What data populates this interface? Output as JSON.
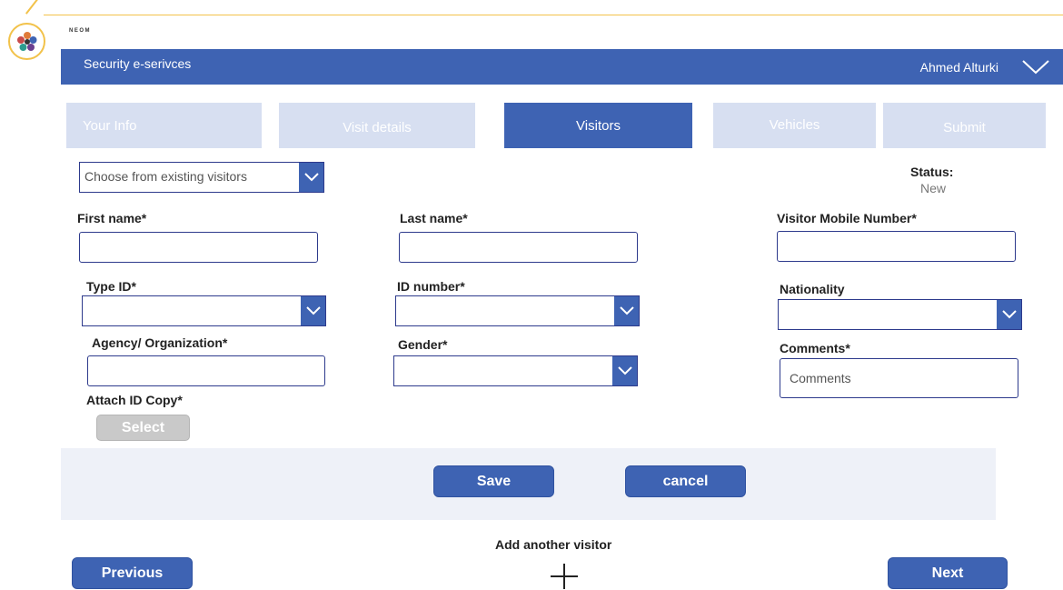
{
  "brand": {
    "name": "NEOM"
  },
  "header": {
    "title": "Security e-serivces",
    "user": "Ahmed Alturki"
  },
  "tabs": [
    {
      "label": "Your Info",
      "active": false
    },
    {
      "label": "Visit details",
      "active": false
    },
    {
      "label": "Visitors",
      "active": true
    },
    {
      "label": "Vehicles",
      "active": false
    },
    {
      "label": "Submit",
      "active": false
    }
  ],
  "visitor_picker": {
    "placeholder": "Choose from existing visitors"
  },
  "status": {
    "label": "Status:",
    "value": "New"
  },
  "form": {
    "first_name": {
      "label": "First name*",
      "value": ""
    },
    "last_name": {
      "label": "Last name*",
      "value": ""
    },
    "mobile": {
      "label": "Visitor Mobile Number*",
      "value": ""
    },
    "type_id": {
      "label": "Type ID*",
      "value": ""
    },
    "id_number": {
      "label": "ID number*",
      "value": ""
    },
    "nationality": {
      "label": "Nationality",
      "value": ""
    },
    "agency": {
      "label": "Agency/ Organization*",
      "value": ""
    },
    "gender": {
      "label": "Gender*",
      "value": ""
    },
    "comments": {
      "label": "Comments*",
      "placeholder": "Comments"
    },
    "attach": {
      "label": "Attach ID Copy*",
      "button": "Select"
    }
  },
  "actions": {
    "save": "Save",
    "cancel": "cancel"
  },
  "footer": {
    "add_visitor": "Add another visitor",
    "previous": "Previous",
    "next": "Next"
  },
  "colors": {
    "primary": "#3e63b3",
    "tab_inactive": "#d7dff1",
    "accent": "#f2c24a",
    "border": "#2d3a8c"
  },
  "icons": {
    "logo": "neom-logo-icon",
    "chevron": "chevron-down-icon",
    "plus": "plus-icon"
  }
}
